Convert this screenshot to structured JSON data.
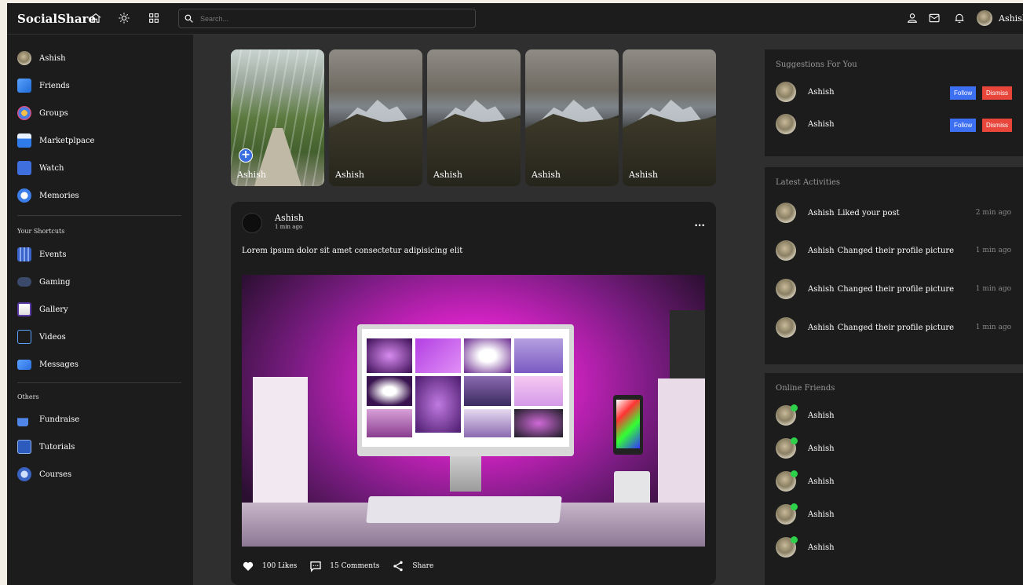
{
  "navbar": {
    "logo": "SocialShare",
    "search_placeholder": "Search...",
    "user_name": "Ashish"
  },
  "sidebar": {
    "main_items": [
      {
        "label": "Ashish",
        "icon": "user-avatar"
      },
      {
        "label": "Friends",
        "icon": "friends-icon"
      },
      {
        "label": "Groups",
        "icon": "groups-icon"
      },
      {
        "label": "Marketplpace",
        "icon": "marketplace-icon"
      },
      {
        "label": "Watch",
        "icon": "watch-icon"
      },
      {
        "label": "Memories",
        "icon": "memories-icon"
      }
    ],
    "shortcuts_title": "Your Shortcuts",
    "shortcuts": [
      {
        "label": "Events",
        "icon": "events-icon"
      },
      {
        "label": "Gaming",
        "icon": "gaming-icon"
      },
      {
        "label": "Gallery",
        "icon": "gallery-icon"
      },
      {
        "label": "Videos",
        "icon": "videos-icon"
      },
      {
        "label": "Messages",
        "icon": "messages-icon"
      }
    ],
    "others_title": "Others",
    "others": [
      {
        "label": "Fundraise",
        "icon": "fundraise-icon"
      },
      {
        "label": "Tutorials",
        "icon": "tutorials-icon"
      },
      {
        "label": "Courses",
        "icon": "courses-icon"
      }
    ]
  },
  "stories": [
    {
      "name": "Ashish",
      "type": "own"
    },
    {
      "name": "Ashish"
    },
    {
      "name": "Ashish"
    },
    {
      "name": "Ashish"
    },
    {
      "name": "Ashish"
    }
  ],
  "post": {
    "author": "Ashish",
    "time": "1 min ago",
    "more": "...",
    "text": "Lorem ipsum dolor sit amet consectetur adipisicing elit",
    "likes": "100 Likes",
    "comments": "15 Comments",
    "share": "Share"
  },
  "suggestions": {
    "title": "Suggestions For You",
    "follow_label": "Follow",
    "dismiss_label": "Dismiss",
    "users": [
      "Ashish",
      "Ashish"
    ]
  },
  "activities": {
    "title": "Latest Activities",
    "items": [
      {
        "user": "Ashish",
        "action": "Liked your post",
        "time": "2 min ago"
      },
      {
        "user": "Ashish",
        "action": "Changed their profile picture",
        "time": "1 min ago"
      },
      {
        "user": "Ashish",
        "action": "Changed their profile picture",
        "time": "1 min ago"
      },
      {
        "user": "Ashish",
        "action": "Changed their profile picture",
        "time": "1 min ago"
      }
    ]
  },
  "online": {
    "title": "Online Friends",
    "users": [
      "Ashish",
      "Ashish",
      "Ashish",
      "Ashish",
      "Ashish"
    ]
  },
  "colors": {
    "follow": "#3d6ff2",
    "dismiss": "#e8453b",
    "online": "#2ed14a",
    "panel_bg": "#1c1c1c",
    "page_bg": "#2f2f2f"
  }
}
